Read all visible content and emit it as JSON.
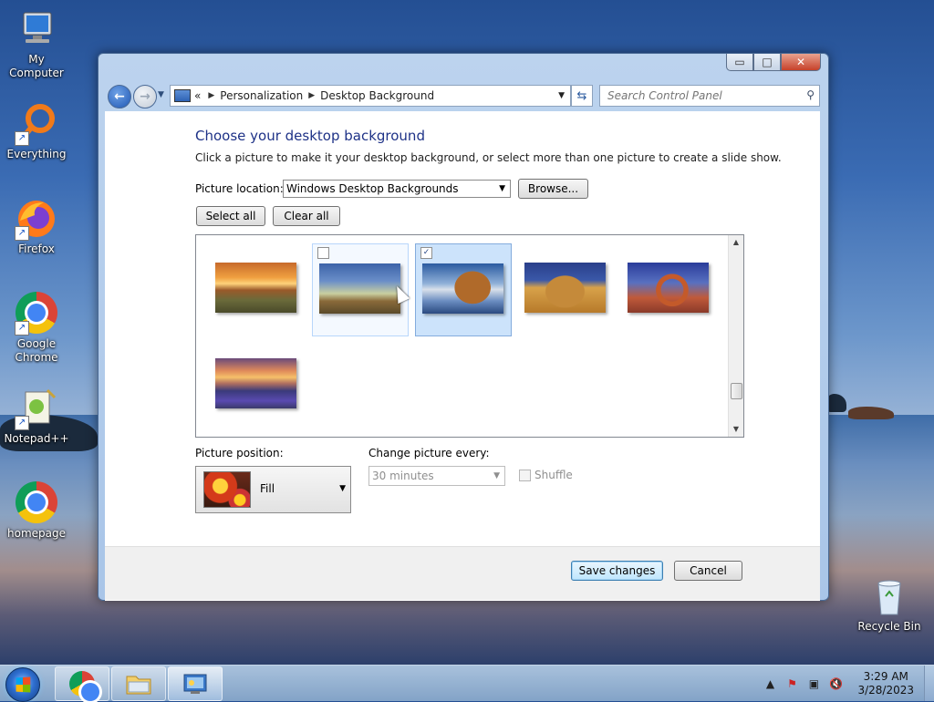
{
  "desktop": {
    "icons": [
      {
        "label": "My Computer"
      },
      {
        "label": "Everything"
      },
      {
        "label": "Firefox"
      },
      {
        "label": "Google Chrome"
      },
      {
        "label": "Notepad++"
      },
      {
        "label": "homepage"
      },
      {
        "label": "Recycle Bin"
      }
    ]
  },
  "window": {
    "breadcrumb_prefix": "«",
    "breadcrumb": [
      "Personalization",
      "Desktop Background"
    ],
    "search_placeholder": "Search Control Panel",
    "caption": {
      "minimize": "▭",
      "maximize": "□",
      "close": "✕"
    }
  },
  "page": {
    "title": "Choose your desktop background",
    "description": "Click a picture to make it your desktop background, or select more than one picture to create a slide show.",
    "picture_location_label": "Picture location:",
    "picture_location_value": "Windows Desktop Backgrounds",
    "browse_label": "Browse...",
    "select_all_label": "Select all",
    "clear_all_label": "Clear all",
    "thumbnails": [
      {
        "name": "sunset-field",
        "checked": false
      },
      {
        "name": "lighthouse",
        "checked": false,
        "hover": true
      },
      {
        "name": "sea-rock",
        "checked": true
      },
      {
        "name": "hay-bale",
        "checked": false
      },
      {
        "name": "arch",
        "checked": false
      },
      {
        "name": "lupine-sunset",
        "checked": false
      }
    ],
    "picture_position_label": "Picture position:",
    "picture_position_value": "Fill",
    "change_picture_label": "Change picture every:",
    "change_picture_value": "30 minutes",
    "shuffle_label": "Shuffle",
    "shuffle_checked": false
  },
  "footer": {
    "save_label": "Save changes",
    "cancel_label": "Cancel"
  },
  "taskbar": {
    "time": "3:29 AM",
    "date": "3/28/2023"
  }
}
